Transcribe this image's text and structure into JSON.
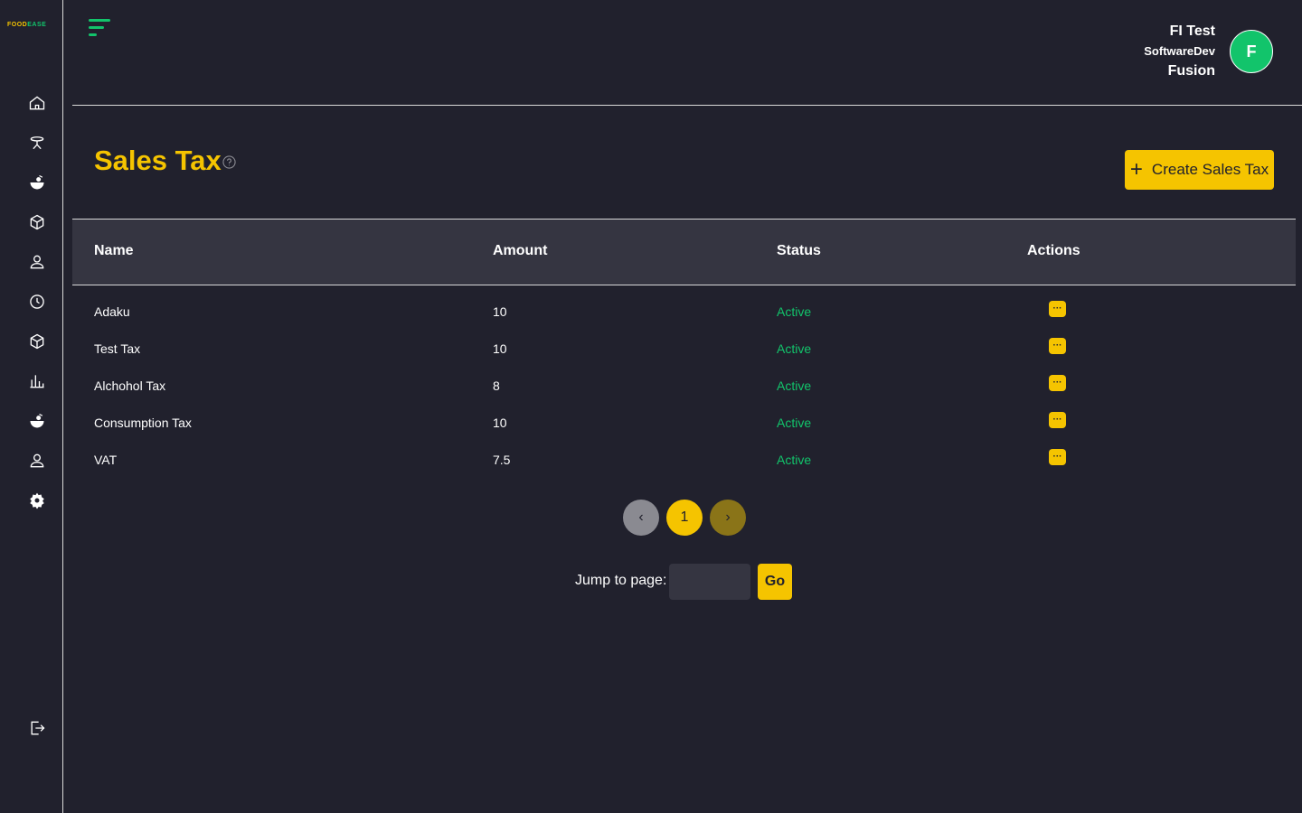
{
  "brand": {
    "logo_part1": "FOOD",
    "logo_part2": "EASE"
  },
  "sidebar": {
    "items": [
      {
        "icon": "home-icon"
      },
      {
        "icon": "dining-table-icon"
      },
      {
        "icon": "food-bowl-icon"
      },
      {
        "icon": "box-icon"
      },
      {
        "icon": "user-icon"
      },
      {
        "icon": "clock-icon"
      },
      {
        "icon": "box-icon"
      },
      {
        "icon": "bar-chart-icon"
      },
      {
        "icon": "food-bowl-icon"
      },
      {
        "icon": "user-icon"
      },
      {
        "icon": "gear-icon"
      }
    ],
    "logout_icon": "logout-icon"
  },
  "header": {
    "user_name": "FI Test",
    "user_org": "SoftwareDev",
    "user_branch": "Fusion",
    "avatar_initial": "F"
  },
  "page": {
    "title": "Sales Tax",
    "create_button_label": "Create Sales Tax",
    "create_button_icon": "+"
  },
  "table": {
    "columns": [
      "Name",
      "Amount",
      "Status",
      "Actions"
    ],
    "rows": [
      {
        "name": "Adaku",
        "amount": "10",
        "status": "Active",
        "action": "···"
      },
      {
        "name": "Test Tax",
        "amount": "10",
        "status": "Active",
        "action": "···"
      },
      {
        "name": "Alchohol Tax",
        "amount": "8",
        "status": "Active",
        "action": "···"
      },
      {
        "name": "Consumption Tax",
        "amount": "10",
        "status": "Active",
        "action": "···"
      },
      {
        "name": "VAT",
        "amount": "7.5",
        "status": "Active",
        "action": "···"
      }
    ]
  },
  "pagination": {
    "prev_icon": "‹",
    "current_page": "1",
    "next_icon": "›",
    "jump_label": "Jump to page:",
    "jump_value": "",
    "go_label": "Go"
  },
  "colors": {
    "accent": "#f5c400",
    "success": "#12c46b",
    "background": "#21212d",
    "table_header": "#353541"
  }
}
